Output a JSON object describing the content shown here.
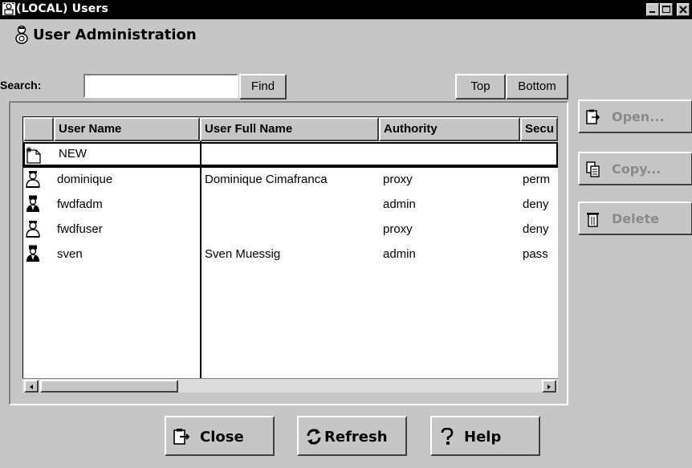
{
  "window": {
    "title": "(LOCAL) Users",
    "minimize": "_",
    "maximize": "□",
    "close": "×"
  },
  "header": {
    "title": "User Administration"
  },
  "search": {
    "label": "Search:",
    "value": "",
    "find_label": "Find",
    "top_label": "Top",
    "bottom_label": "Bottom"
  },
  "side_buttons": {
    "open": "Open...",
    "copy": "Copy...",
    "delete": "Delete"
  },
  "table": {
    "columns": [
      "",
      "User Name",
      "User Full Name",
      "Authority",
      "Secu"
    ],
    "new_row": "NEW",
    "rows": [
      {
        "icon": "proxy-user-icon",
        "name": "dominique",
        "full_name": "Dominique Cimafranca",
        "authority": "proxy",
        "security": "perm"
      },
      {
        "icon": "admin-user-icon",
        "name": "fwdfadm",
        "full_name": "",
        "authority": "admin",
        "security": "deny"
      },
      {
        "icon": "proxy-user-icon",
        "name": "fwdfuser",
        "full_name": "",
        "authority": "proxy",
        "security": "deny"
      },
      {
        "icon": "admin-user-icon",
        "name": "sven",
        "full_name": "Sven Muessig",
        "authority": "admin",
        "security": "pass"
      }
    ]
  },
  "footer": {
    "close": "Close",
    "refresh": "Refresh",
    "help": "Help"
  },
  "colors": {
    "background": "#c6c6c6",
    "titlebar": "#000000",
    "disabled_text": "#8a8a8a"
  }
}
